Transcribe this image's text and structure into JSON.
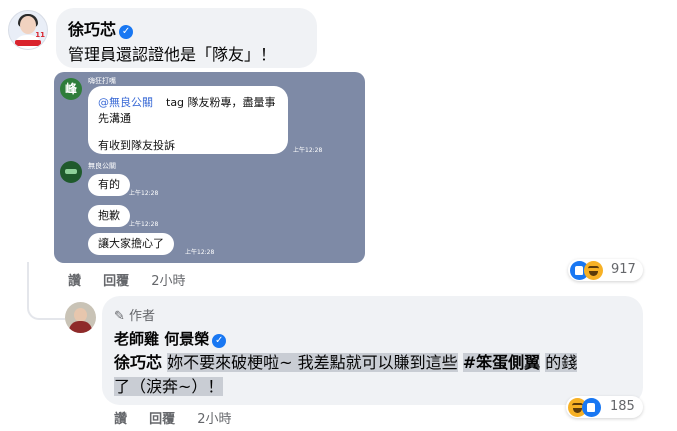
{
  "comment1": {
    "avatar_number": "11",
    "author": "徐巧芯",
    "text": "管理員還認證他是「隊友」！",
    "actions": {
      "like": "讚",
      "reply": "回覆",
      "time": "2小時"
    },
    "reaction_count": "917"
  },
  "line_chat": {
    "group_avatar_text": "峰",
    "sender1": "嗨狂打嘴",
    "msg1_mention": "@無良公關",
    "msg1_line1": "tag 隊友粉專，盡量事",
    "msg1_line2": "先溝通",
    "msg1_line3": "有收到隊友投訴",
    "time": "上午12:28",
    "sender2": "無良公關",
    "msg2": "有的",
    "msg3": "抱歉",
    "msg4": "讓大家擔心了"
  },
  "reply1": {
    "author_badge": "作者",
    "author": "老師雞 何景榮",
    "mention": "徐巧芯",
    "text1": "妳不要來破梗啦~ 我差點就可以賺到這些",
    "hashtag": "#笨蛋側翼",
    "text2": "的錢",
    "text3": "了（淚奔~）！",
    "actions": {
      "like": "讚",
      "reply": "回覆",
      "time": "2小時"
    },
    "reaction_count": "185"
  },
  "colors": {
    "accent": "#1877f2",
    "bubble": "#f0f2f5",
    "secondary_text": "#65676b",
    "line_bg": "#7e8aa6"
  }
}
